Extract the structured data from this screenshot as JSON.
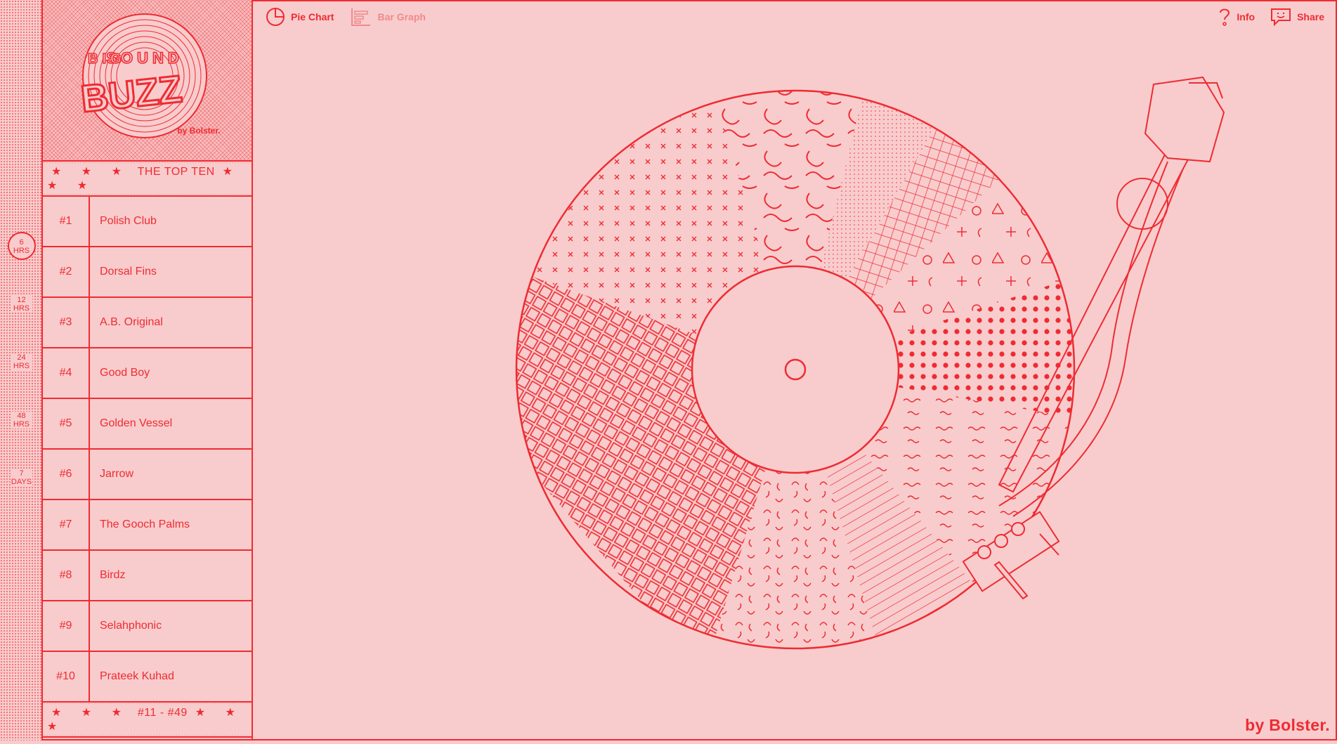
{
  "time_filters": [
    {
      "num": "6",
      "unit": "HRS",
      "active": true
    },
    {
      "num": "12",
      "unit": "HRS",
      "active": false
    },
    {
      "num": "24",
      "unit": "HRS",
      "active": false
    },
    {
      "num": "48",
      "unit": "HRS",
      "active": false
    },
    {
      "num": "7",
      "unit": "DAYS",
      "active": false
    }
  ],
  "logo": {
    "big": "BIG",
    "sound": "SOUND",
    "buzz": "BUZZ",
    "by": "by Bolster."
  },
  "list": {
    "header_stars_left": "★ ★ ★",
    "header_title": "THE TOP TEN",
    "header_stars_right": "★ ★ ★",
    "rows": [
      {
        "rank": "#1",
        "name": "Polish Club"
      },
      {
        "rank": "#2",
        "name": "Dorsal Fins"
      },
      {
        "rank": "#3",
        "name": "A.B. Original"
      },
      {
        "rank": "#4",
        "name": "Good Boy"
      },
      {
        "rank": "#5",
        "name": "Golden Vessel"
      },
      {
        "rank": "#6",
        "name": "Jarrow"
      },
      {
        "rank": "#7",
        "name": "The Gooch Palms"
      },
      {
        "rank": "#8",
        "name": "Birdz"
      },
      {
        "rank": "#9",
        "name": "Selahphonic"
      },
      {
        "rank": "#10",
        "name": "Prateek Kuhad"
      }
    ],
    "footer_stars_left": "★ ★ ★",
    "footer_title": "#11 - #49",
    "footer_stars_right": "★ ★ ★"
  },
  "toolbar": {
    "pie_label": "Pie Chart",
    "bar_label": "Bar Graph",
    "info_label": "Info",
    "share_label": "Share"
  },
  "brand": "by Bolster.",
  "colors": {
    "accent": "#ef2b32",
    "background": "#f8cccd",
    "muted": "#ef8a8c"
  }
}
